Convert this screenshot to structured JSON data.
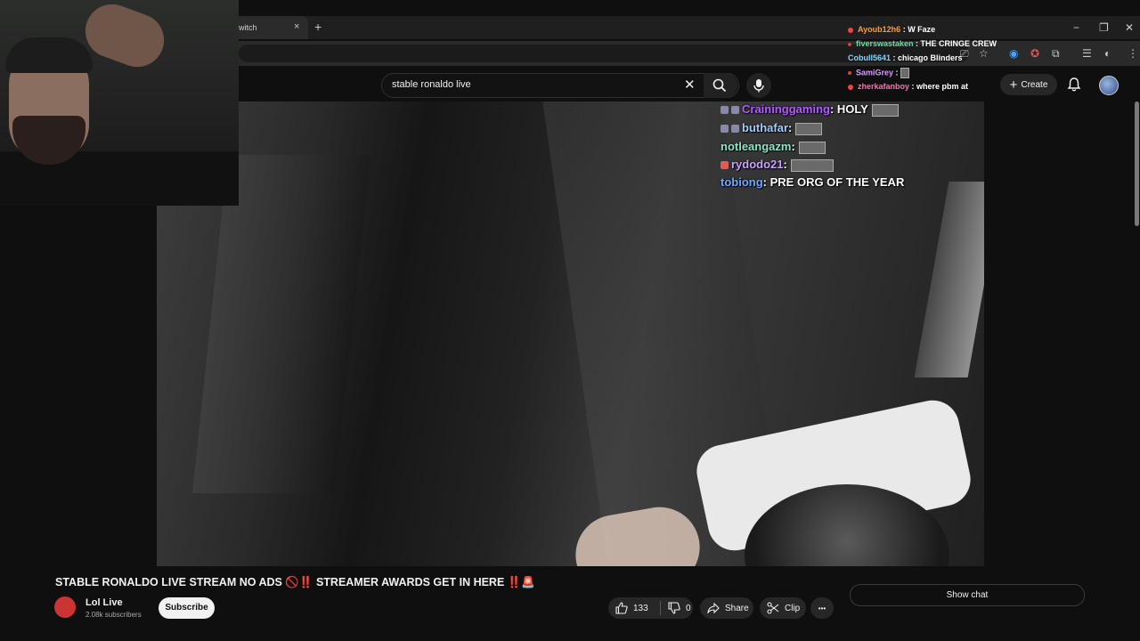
{
  "browser": {
    "tab_title": "witch",
    "tab_close": "×",
    "new_tab": "+",
    "window": {
      "minimize": "−",
      "restore": "❐",
      "close": "✕"
    }
  },
  "youtube": {
    "search_value": "stable ronaldo live",
    "clear_icon": "✕",
    "create_label": "Create",
    "create_icon": "+"
  },
  "twitch_chat": [
    {
      "user": "Ayoub12h6",
      "message": "W Faze",
      "color": "#ff9a3c"
    },
    {
      "user": "fiverswastaken",
      "message": "THE CRINGE CREW",
      "color": "#5ee3a1"
    },
    {
      "user": "Cobull5641",
      "message": "chicago Blinders",
      "color": "#7fd6ff"
    },
    {
      "user": "SamiGrey",
      "message": "",
      "color": "#d89cff"
    },
    {
      "user": "zherkafanboy",
      "message": "where pbm at",
      "color": "#ff6ea8"
    }
  ],
  "overlay_chat": [
    {
      "user": "Craininggaming",
      "message": "HOLY",
      "color": "#b05cff",
      "emote": true
    },
    {
      "user": "buthafar",
      "message": "",
      "color": "#9fd0ff",
      "emote": true
    },
    {
      "user": "notleangazm",
      "message": "",
      "color": "#8ee6c8",
      "emote": true
    },
    {
      "user": "rydodo21",
      "message": "",
      "color": "#c9a2ff",
      "emote": true
    },
    {
      "user": "tobiong",
      "message": "PRE ORG OF THE YEAR",
      "color": "#6fa8ff",
      "emote": false
    }
  ],
  "video": {
    "title": "STABLE RONALDO LIVE STREAM NO ADS 🚫‼️ STREAMER AWARDS GET IN HERE ‼️🚨",
    "channel_name": "Lol Live",
    "subscribers": "2.08k subscribers",
    "subscribe_label": "Subscribe",
    "likes": "133",
    "dislikes": "0",
    "share_label": "Share",
    "clip_label": "Clip",
    "more_label": "•••",
    "show_chat_label": "Show chat"
  }
}
